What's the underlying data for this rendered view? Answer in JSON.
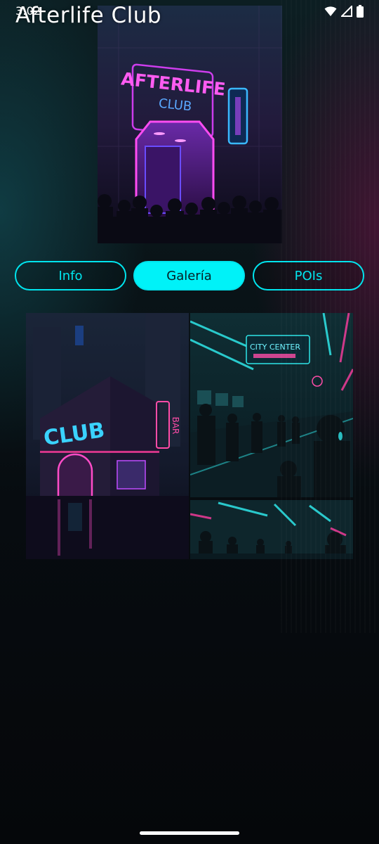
{
  "status_bar": {
    "time": "3:02",
    "icons": [
      "wifi-icon",
      "signal-icon",
      "battery-icon"
    ]
  },
  "app": {
    "title": "Afterlife Club"
  },
  "hero": {
    "sign_main": "AFTERLIFE",
    "sign_sub": "CLUB"
  },
  "tabs": [
    {
      "label": "Info",
      "active": false
    },
    {
      "label": "Galería",
      "active": true
    },
    {
      "label": "POIs",
      "active": false
    }
  ],
  "gallery": {
    "images": [
      {
        "name": "club-building",
        "sign_main": "CLUB",
        "sign_side": "BAR"
      },
      {
        "name": "metro-station",
        "sign_main": "CITY CENTER"
      },
      {
        "name": "metro-tunnel"
      }
    ]
  },
  "colors": {
    "accent_cyan": "#00e5ee",
    "accent_magenta": "#e040ff",
    "background": "#05080c"
  }
}
